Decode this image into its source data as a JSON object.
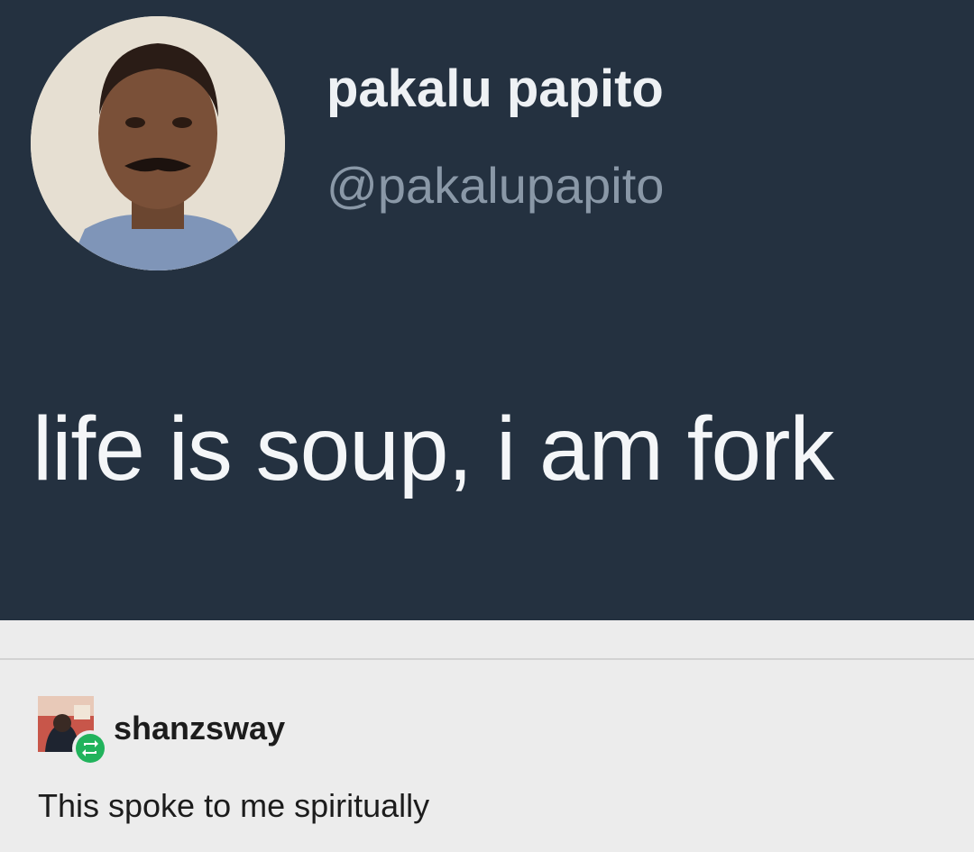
{
  "tweet": {
    "display_name": "pakalu papito",
    "handle": "@pakalupapito",
    "text": "life is soup, i am fork",
    "avatar_icon": "profile-photo-icon",
    "background_color": "#243140"
  },
  "reblog": {
    "username": "shanzsway",
    "comment": "This spoke to me spiritually",
    "avatar_icon": "user-avatar-icon",
    "badge_icon": "reblog-icon",
    "badge_color": "#21b35c"
  }
}
